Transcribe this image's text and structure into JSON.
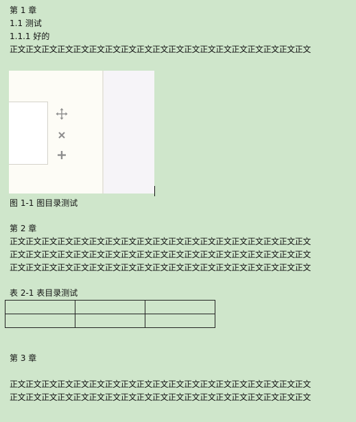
{
  "chapter1": {
    "heading": "第 1 章",
    "section": "1.1 测试",
    "subsection": "1.1.1  好的",
    "body_lines": [
      "正文正文正文正文正文正文正文正文正文正文正文正文正文正文正文正文正文正文正文"
    ]
  },
  "figure": {
    "icons": [
      "move-icon",
      "close-icon",
      "plus-icon"
    ],
    "caption": "图 1-1  图目录测试"
  },
  "chapter2": {
    "heading": "第 2 章",
    "body_lines": [
      "正文正文正文正文正文正文正文正文正文正文正文正文正文正文正文正文正文正文正文",
      "正文正文正文正文正文正文正文正文正文正文正文正文正文正文正文正文正文正文正文",
      "正文正文正文正文正文正文正文正文正文正文正文正文正文正文正文正文正文正文正文"
    ]
  },
  "table": {
    "caption": "表 2-1  表目录测试",
    "rows": [
      [
        "",
        "",
        ""
      ],
      [
        "",
        "",
        ""
      ]
    ]
  },
  "chapter3": {
    "heading": "第 3 章",
    "body_lines": [
      "正文正文正文正文正文正文正文正文正文正文正文正文正文正文正文正文正文正文正文",
      "正文正文正文正文正文正文正文正文正文正文正文正文正文正文正文正文正文正文正文"
    ]
  },
  "colors": {
    "page_background": "#cfe6cb",
    "text": "#111111"
  }
}
